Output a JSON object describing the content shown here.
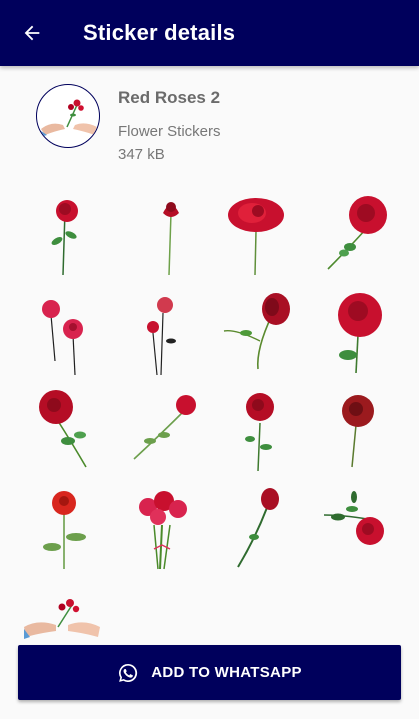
{
  "appbar": {
    "title": "Sticker details",
    "back_icon": "arrow-back-icon"
  },
  "pack": {
    "name": "Red Roses 2",
    "author": "Flower Stickers",
    "size": "347 kB",
    "tray_icon": "hands-giving-rose-icon"
  },
  "stickers": [
    "single-rose-sticker",
    "long-stem-rose-sticker",
    "rose-bloom-sticker",
    "rose-with-leaves-sticker",
    "two-pink-roses-sticker",
    "sketch-roses-sticker",
    "bud-rose-sticker",
    "large-red-rose-sticker",
    "rose-with-stem-sticker",
    "lying-rose-sticker",
    "rose-cluster-sticker",
    "dark-rose-sticker",
    "orange-rose-sticker",
    "rose-bouquet-sticker",
    "dark-rosebud-sticker",
    "rose-sprig-sticker",
    "hands-giving-rose-sticker"
  ],
  "cta": {
    "label": "ADD TO WHATSAPP",
    "icon": "whatsapp-icon"
  },
  "colors": {
    "primary": "#00005c",
    "rose": "#c8102e",
    "leaf": "#3e8e3e"
  }
}
